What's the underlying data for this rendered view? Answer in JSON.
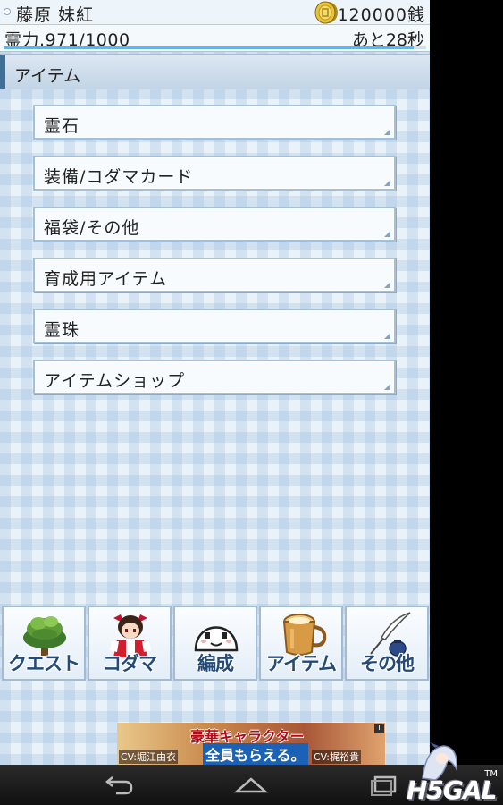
{
  "status": {
    "player_name": "藤原 妹紅",
    "money": "120000銭",
    "reiryoku": "霊力.971/1000",
    "recover": "あと28秒",
    "energy_fraction": 0.971
  },
  "section": {
    "title": "アイテム"
  },
  "menu": [
    {
      "label": "霊石"
    },
    {
      "label": "装備/コダマカード"
    },
    {
      "label": "福袋/その他"
    },
    {
      "label": "育成用アイテム"
    },
    {
      "label": "霊珠"
    },
    {
      "label": "アイテムショップ"
    }
  ],
  "nav": [
    {
      "label": "クエスト",
      "icon": "tree-icon"
    },
    {
      "label": "コダマ",
      "icon": "shrine-maiden-icon"
    },
    {
      "label": "編成",
      "icon": "kodama-face-icon"
    },
    {
      "label": "アイテム",
      "icon": "mug-icon"
    },
    {
      "label": "その他",
      "icon": "quill-icon"
    }
  ],
  "ad": {
    "title": "豪華キャラクター",
    "subtitle": "全員もらえる。",
    "cv1": "CV:堀江由衣",
    "cv2": "CV:梶裕貴",
    "info": "i"
  },
  "watermark": {
    "text": "H5GAL",
    "tm": "TM"
  },
  "colors": {
    "accent": "#3e6f99",
    "nav_text": "#244a77",
    "energy": "#69b3e3"
  }
}
